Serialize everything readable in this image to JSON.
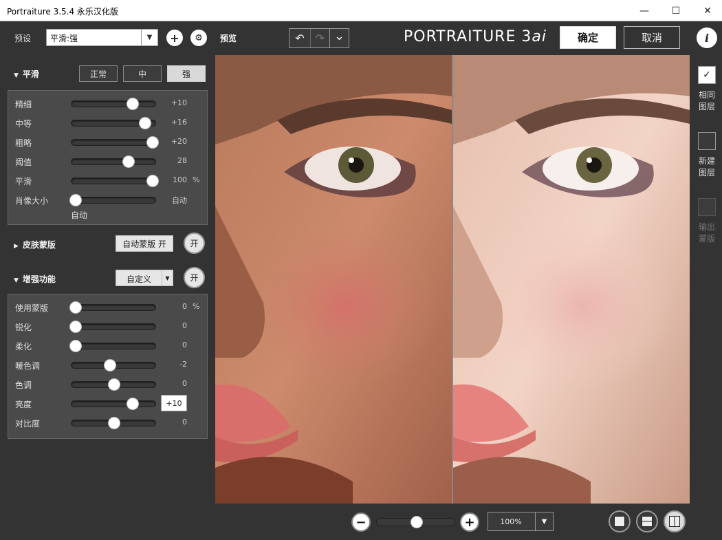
{
  "window": {
    "title": "Portraiture 3.5.4 永乐汉化版",
    "minimize_glyph": "—",
    "maximize_glyph": "☐",
    "close_glyph": "✕"
  },
  "presets": {
    "label": "预设",
    "selected": "平滑:强",
    "add_glyph": "+",
    "settings_glyph": "⚙"
  },
  "smoothing": {
    "header": "平滑",
    "buttons": [
      "正常",
      "中",
      "强"
    ],
    "active_button": "强",
    "sliders": [
      {
        "label": "精细",
        "value": "+10",
        "level": 0.72
      },
      {
        "label": "中等",
        "value": "+16",
        "level": 0.86
      },
      {
        "label": "粗略",
        "value": "+20",
        "level": 0.95
      },
      {
        "label": "阈值",
        "value": "28",
        "level": 0.67
      },
      {
        "label": "平滑",
        "value": "100",
        "unit": "%",
        "level": 0.95
      },
      {
        "label": "肖像大小",
        "value": "自动",
        "level": 0.05
      }
    ],
    "portrait_size_mode": "自动"
  },
  "skin_mask": {
    "header": "皮肤蒙版",
    "auto_button": "自动蒙版 开",
    "toggle": "开"
  },
  "enhancements": {
    "header": "增强功能",
    "mode": "自定义",
    "toggle": "开",
    "sliders": [
      {
        "label": "使用蒙版",
        "value": "0",
        "unit": "%",
        "level": 0.05
      },
      {
        "label": "锐化",
        "value": "0",
        "level": 0.05
      },
      {
        "label": "柔化",
        "value": "0",
        "level": 0.05
      },
      {
        "label": "暖色调",
        "value": "-2",
        "level": 0.45
      },
      {
        "label": "色调",
        "value": "0",
        "level": 0.5
      },
      {
        "label": "亮度",
        "value": "+10",
        "editing": true,
        "level": 0.72
      },
      {
        "label": "对比度",
        "value": "0",
        "level": 0.5
      }
    ]
  },
  "toolbar": {
    "preview_label": "预览",
    "undo_glyph": "↶",
    "redo_glyph": "↷",
    "history_glyph": "⌄",
    "logo_main": "PORTRAITURE 3",
    "logo_ai": "ai",
    "ok": "确定",
    "cancel": "取消",
    "info_glyph": "i"
  },
  "layers": {
    "same_layer": "相同图层",
    "same_layer_checked": true,
    "check_glyph": "✓",
    "new_layer": "新建图层",
    "output_mask": "输出蒙版"
  },
  "zoom": {
    "minus_glyph": "−",
    "plus_glyph": "+",
    "level": 0.5,
    "value": "100%",
    "dropdown_glyph": "▼"
  },
  "colors": {
    "panel_bg": "#333333",
    "slider_box_bg": "#4a4a4a",
    "accent_light": "#ffffff"
  }
}
